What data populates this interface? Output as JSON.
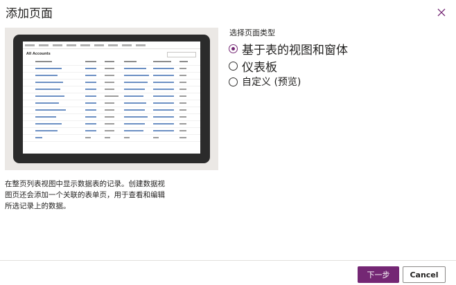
{
  "dialog": {
    "title": "添加页面",
    "close_icon": "close-icon"
  },
  "preview": {
    "view_title": "All Accounts"
  },
  "page_type": {
    "heading": "选择页面类型",
    "options": [
      {
        "label": "基于表的视图和窗体",
        "selected": true
      },
      {
        "label": "仪表板",
        "selected": false
      },
      {
        "label": "自定义 (预览)",
        "selected": false
      }
    ]
  },
  "description": "在整页列表视图中显示数据表的记录。创建数据视图页还会添加一个关联的表单页，用于查看和编辑所选记录上的数据。",
  "footer": {
    "next_label": "下一步",
    "cancel_label": "Cancel"
  },
  "colors": {
    "accent": "#742774"
  }
}
